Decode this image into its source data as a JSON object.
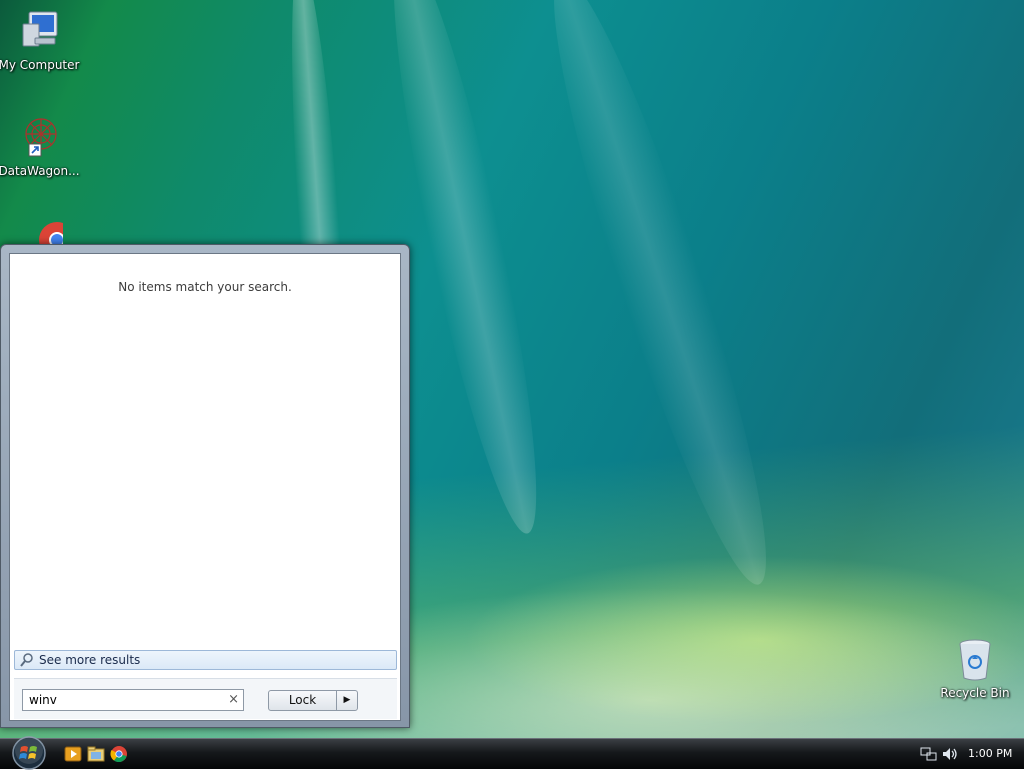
{
  "desktop": {
    "icons": [
      {
        "label": "My Computer",
        "icon": "computer-icon"
      },
      {
        "label": "DataWagon...",
        "icon": "datawagon-shortcut-icon"
      },
      {
        "label": "",
        "icon": "chrome-icon"
      },
      {
        "label": "Recycle Bin",
        "icon": "recycle-bin-icon"
      }
    ]
  },
  "start_menu": {
    "no_results_text": "No items match your search.",
    "see_more_label": "See more results",
    "search_value": "winv",
    "search_clear_glyph": "×",
    "lock_label": "Lock",
    "lock_arrow_glyph": "▶"
  },
  "taskbar": {
    "start_button_icon": "windows-orb-icon",
    "quick_launch": [
      "media-player-icon",
      "file-explorer-icon",
      "chrome-icon"
    ],
    "tray": [
      "network-icon",
      "volume-icon"
    ],
    "clock": "1:00 PM"
  },
  "colors": {
    "accent": "#1d7f96",
    "taskbar": "#15181b",
    "menu_frame": "#a9b7c6"
  }
}
